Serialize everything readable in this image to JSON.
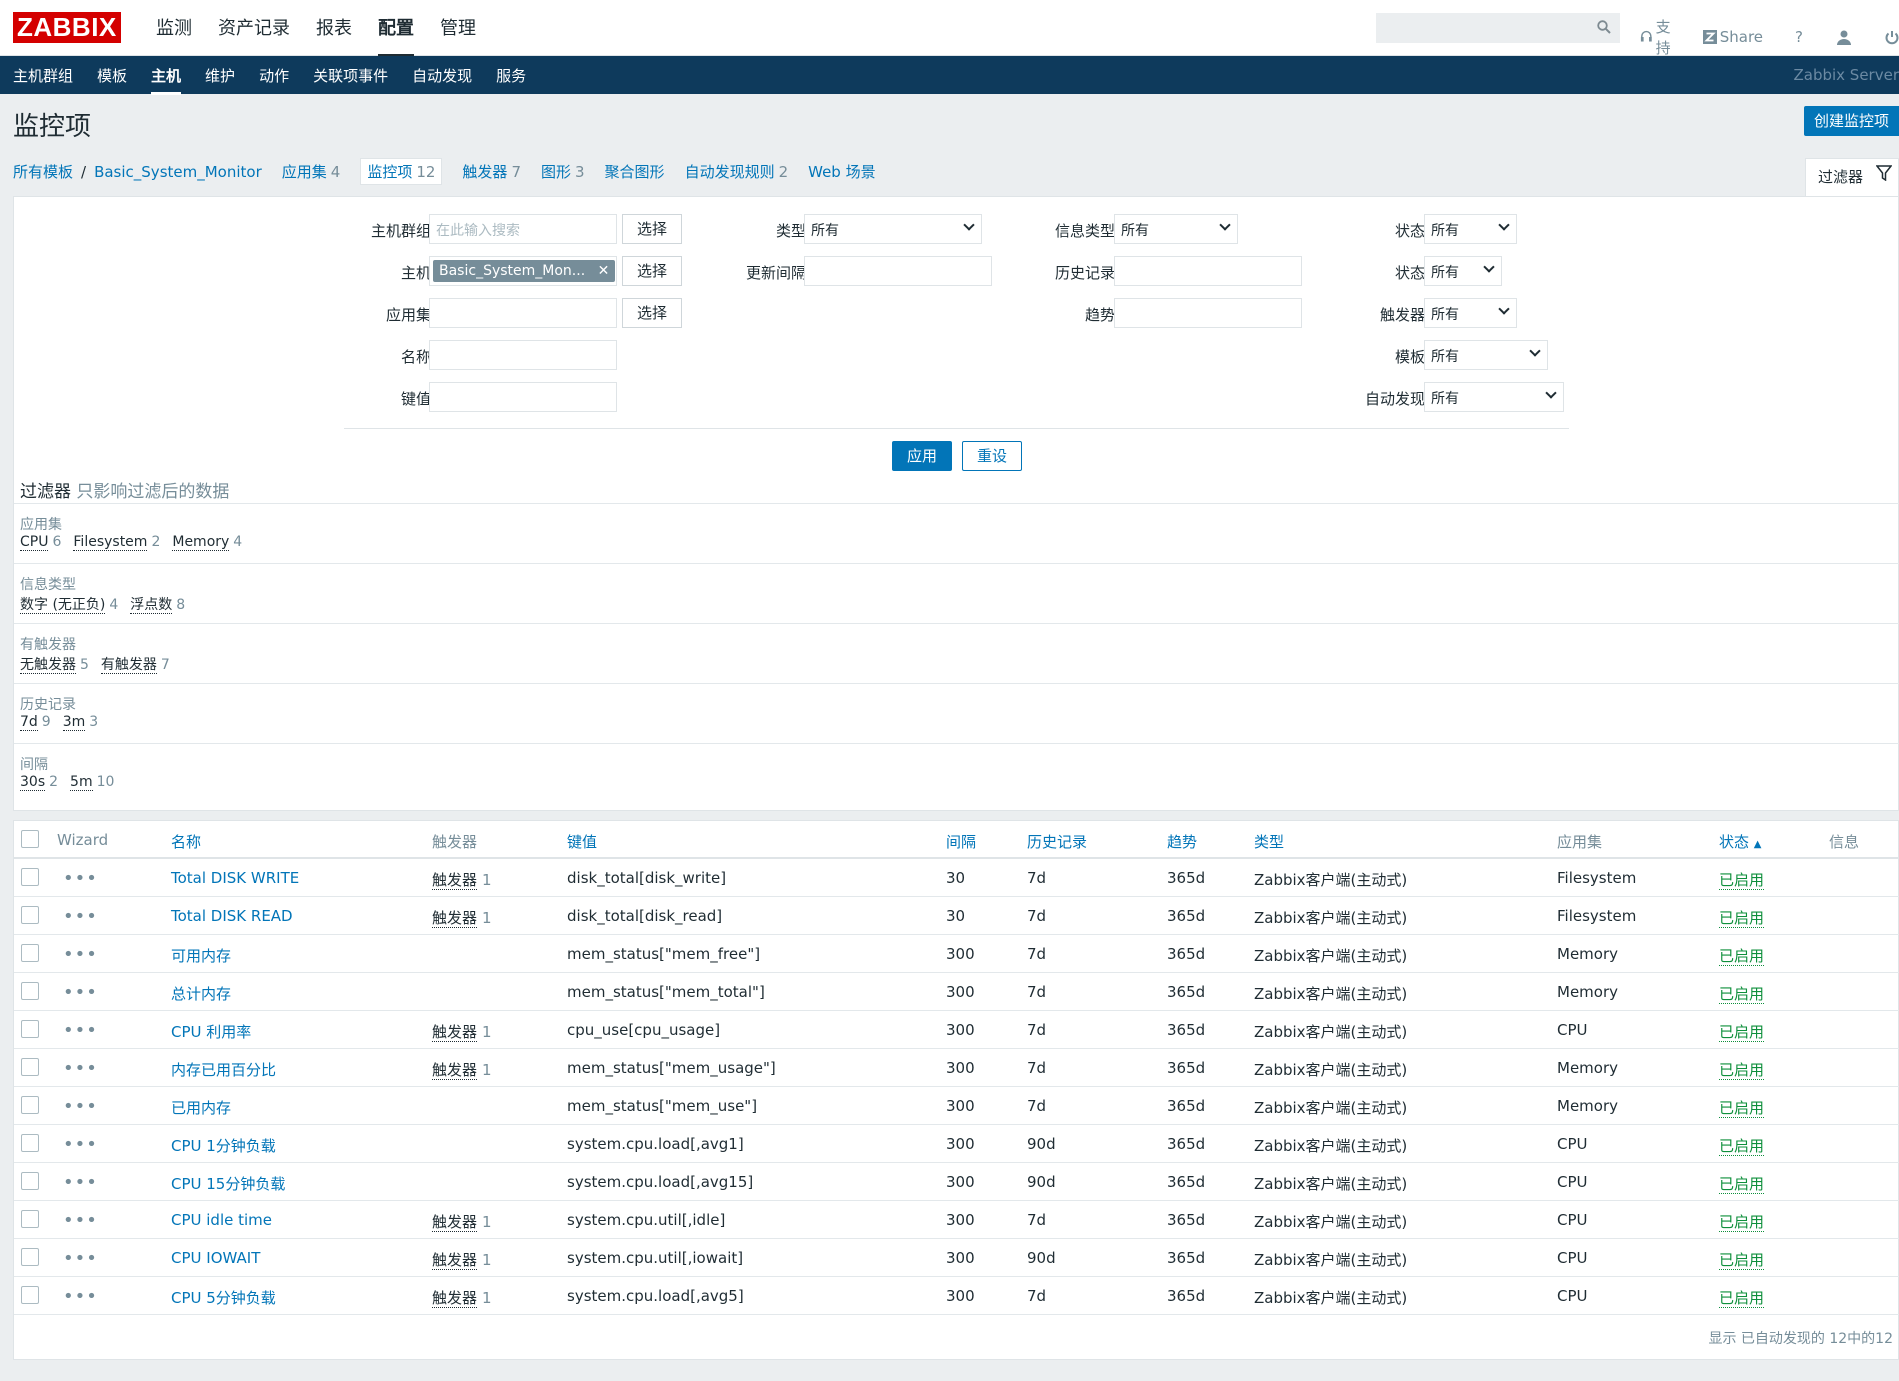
{
  "logo": "ZABBIX",
  "top_nav": [
    {
      "label": "监测"
    },
    {
      "label": "资产记录"
    },
    {
      "label": "报表"
    },
    {
      "label": "配置"
    },
    {
      "label": "管理"
    }
  ],
  "tools": {
    "support": "支持",
    "share": "Share",
    "help": "?"
  },
  "sub_nav": [
    {
      "label": "主机群组"
    },
    {
      "label": "模板"
    },
    {
      "label": "主机"
    },
    {
      "label": "维护"
    },
    {
      "label": "动作"
    },
    {
      "label": "关联项事件"
    },
    {
      "label": "自动发现"
    },
    {
      "label": "服务"
    }
  ],
  "server_name": "Zabbix Server",
  "page_title": "监控项",
  "create_button": "创建监控项",
  "breadcrumb": {
    "all_templates": "所有模板",
    "sep": "/",
    "host": "Basic_System_Monitor",
    "tabs": [
      {
        "label": "应用集",
        "count": "4"
      },
      {
        "label": "监控项",
        "count": "12"
      },
      {
        "label": "触发器",
        "count": "7"
      },
      {
        "label": "图形",
        "count": "3"
      },
      {
        "label": "聚合图形",
        "count": ""
      },
      {
        "label": "自动发现规则",
        "count": "2"
      },
      {
        "label": "Web 场景",
        "count": ""
      }
    ]
  },
  "filter_tab": "过滤器",
  "filter": {
    "host_group_label": "主机群组",
    "host_group_placeholder": "在此输入搜索",
    "select_btn": "选择",
    "host_label": "主机",
    "host_tag": "Basic_System_Mon...",
    "app_label": "应用集",
    "name_label": "名称",
    "key_label": "键值",
    "type_label": "类型",
    "type_value": "所有",
    "interval_label": "更新间隔",
    "info_type_label": "信息类型",
    "info_type_value": "所有",
    "history_label": "历史记录",
    "trend_label": "趋势",
    "state_label": "状态",
    "state_value": "所有",
    "status_label": "状态",
    "status_value": "所有",
    "triggers_label": "触发器",
    "triggers_value": "所有",
    "template_label": "模板",
    "template_value": "所有",
    "discovery_label": "自动发现",
    "discovery_value": "所有",
    "apply": "应用",
    "reset": "重设"
  },
  "subfilter": {
    "title": "过滤器",
    "hint": "只影响过滤后的数据",
    "groups": [
      {
        "title": "应用集",
        "items": [
          {
            "label": "CPU",
            "count": "6"
          },
          {
            "label": "Filesystem",
            "count": "2"
          },
          {
            "label": "Memory",
            "count": "4"
          }
        ]
      },
      {
        "title": "信息类型",
        "items": [
          {
            "label": "数字 (无正负)",
            "count": "4"
          },
          {
            "label": "浮点数",
            "count": "8"
          }
        ]
      },
      {
        "title": "有触发器",
        "items": [
          {
            "label": "无触发器",
            "count": "5"
          },
          {
            "label": "有触发器",
            "count": "7"
          }
        ]
      },
      {
        "title": "历史记录",
        "items": [
          {
            "label": "7d",
            "count": "9"
          },
          {
            "label": "3m",
            "count": "3"
          }
        ]
      },
      {
        "title": "间隔",
        "items": [
          {
            "label": "30s",
            "count": "2"
          },
          {
            "label": "5m",
            "count": "10"
          }
        ]
      }
    ]
  },
  "table": {
    "headers": {
      "wizard": "Wizard",
      "name": "名称",
      "triggers": "触发器",
      "key": "键值",
      "interval": "间隔",
      "history": "历史记录",
      "trends": "趋势",
      "type": "类型",
      "apps": "应用集",
      "status": "状态",
      "info": "信息"
    },
    "sort_arrow": "▲",
    "rows": [
      {
        "name": "Total DISK WRITE",
        "trig": "触发器",
        "trig_count": "1",
        "key": "disk_total[disk_write]",
        "interval": "30",
        "history": "7d",
        "trends": "365d",
        "type": "Zabbix客户端(主动式)",
        "app": "Filesystem",
        "status": "已启用"
      },
      {
        "name": "Total DISK READ",
        "trig": "触发器",
        "trig_count": "1",
        "key": "disk_total[disk_read]",
        "interval": "30",
        "history": "7d",
        "trends": "365d",
        "type": "Zabbix客户端(主动式)",
        "app": "Filesystem",
        "status": "已启用"
      },
      {
        "name": "可用内存",
        "trig": "",
        "trig_count": "",
        "key": "mem_status[\"mem_free\"]",
        "interval": "300",
        "history": "7d",
        "trends": "365d",
        "type": "Zabbix客户端(主动式)",
        "app": "Memory",
        "status": "已启用"
      },
      {
        "name": "总计内存",
        "trig": "",
        "trig_count": "",
        "key": "mem_status[\"mem_total\"]",
        "interval": "300",
        "history": "7d",
        "trends": "365d",
        "type": "Zabbix客户端(主动式)",
        "app": "Memory",
        "status": "已启用"
      },
      {
        "name": "CPU 利用率",
        "trig": "触发器",
        "trig_count": "1",
        "key": "cpu_use[cpu_usage]",
        "interval": "300",
        "history": "7d",
        "trends": "365d",
        "type": "Zabbix客户端(主动式)",
        "app": "CPU",
        "status": "已启用"
      },
      {
        "name": "内存已用百分比",
        "trig": "触发器",
        "trig_count": "1",
        "key": "mem_status[\"mem_usage\"]",
        "interval": "300",
        "history": "7d",
        "trends": "365d",
        "type": "Zabbix客户端(主动式)",
        "app": "Memory",
        "status": "已启用"
      },
      {
        "name": "已用内存",
        "trig": "",
        "trig_count": "",
        "key": "mem_status[\"mem_use\"]",
        "interval": "300",
        "history": "7d",
        "trends": "365d",
        "type": "Zabbix客户端(主动式)",
        "app": "Memory",
        "status": "已启用"
      },
      {
        "name": "CPU 1分钟负载",
        "trig": "",
        "trig_count": "",
        "key": "system.cpu.load[,avg1]",
        "interval": "300",
        "history": "90d",
        "trends": "365d",
        "type": "Zabbix客户端(主动式)",
        "app": "CPU",
        "status": "已启用"
      },
      {
        "name": "CPU 15分钟负载",
        "trig": "",
        "trig_count": "",
        "key": "system.cpu.load[,avg15]",
        "interval": "300",
        "history": "90d",
        "trends": "365d",
        "type": "Zabbix客户端(主动式)",
        "app": "CPU",
        "status": "已启用"
      },
      {
        "name": "CPU idle time",
        "trig": "触发器",
        "trig_count": "1",
        "key": "system.cpu.util[,idle]",
        "interval": "300",
        "history": "7d",
        "trends": "365d",
        "type": "Zabbix客户端(主动式)",
        "app": "CPU",
        "status": "已启用"
      },
      {
        "name": "CPU IOWAIT",
        "trig": "触发器",
        "trig_count": "1",
        "key": "system.cpu.util[,iowait]",
        "interval": "300",
        "history": "90d",
        "trends": "365d",
        "type": "Zabbix客户端(主动式)",
        "app": "CPU",
        "status": "已启用"
      },
      {
        "name": "CPU 5分钟负载",
        "trig": "触发器",
        "trig_count": "1",
        "key": "system.cpu.load[,avg5]",
        "interval": "300",
        "history": "7d",
        "trends": "365d",
        "type": "Zabbix客户端(主动式)",
        "app": "CPU",
        "status": "已启用"
      }
    ],
    "footer": "显示 已自动发现的 12中的12"
  }
}
